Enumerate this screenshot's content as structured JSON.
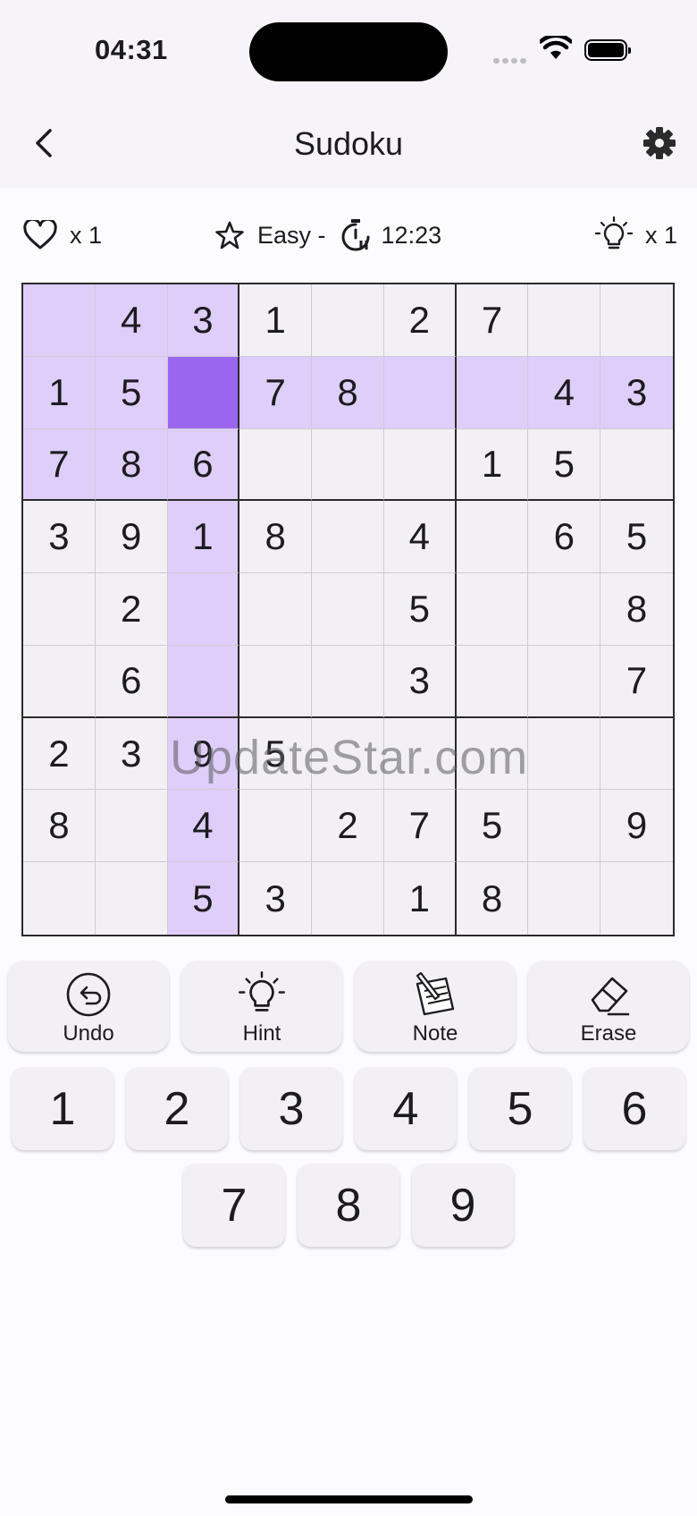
{
  "status_bar": {
    "time": "04:31"
  },
  "app_bar": {
    "title": "Sudoku"
  },
  "info": {
    "lives": "x 1",
    "difficulty": "Easy -",
    "timer": "12:23",
    "hints": "x 1"
  },
  "board": {
    "rows": [
      [
        "",
        "4",
        "3",
        "1",
        "",
        "2",
        "7",
        "",
        ""
      ],
      [
        "1",
        "5",
        "",
        "7",
        "8",
        "",
        "",
        "4",
        "3"
      ],
      [
        "7",
        "8",
        "6",
        "",
        "",
        "",
        "1",
        "5",
        ""
      ],
      [
        "3",
        "9",
        "1",
        "8",
        "",
        "4",
        "",
        "6",
        "5"
      ],
      [
        "",
        "2",
        "",
        "",
        "",
        "5",
        "",
        "",
        "8"
      ],
      [
        "",
        "6",
        "",
        "",
        "",
        "3",
        "",
        "",
        "7"
      ],
      [
        "2",
        "3",
        "9",
        "5",
        "",
        "",
        "",
        "",
        ""
      ],
      [
        "8",
        "",
        "4",
        "",
        "2",
        "7",
        "5",
        "",
        "9"
      ],
      [
        "",
        "",
        "5",
        "3",
        "",
        "1",
        "8",
        "",
        ""
      ]
    ],
    "selected_cell": {
      "row": 1,
      "col": 2
    },
    "colors": {
      "highlight": "#dfcdfa",
      "selected": "#9b66ef",
      "cell": "#f2f0f4"
    }
  },
  "watermark": "UpdateStar.com",
  "tools": [
    {
      "label": "Undo",
      "icon": "undo-icon"
    },
    {
      "label": "Hint",
      "icon": "lightbulb-icon"
    },
    {
      "label": "Note",
      "icon": "notepad-pencil-icon"
    },
    {
      "label": "Erase",
      "icon": "eraser-icon"
    }
  ],
  "numpad": {
    "row1": [
      "1",
      "2",
      "3",
      "4",
      "5",
      "6"
    ],
    "row2": [
      "7",
      "8",
      "9"
    ]
  }
}
